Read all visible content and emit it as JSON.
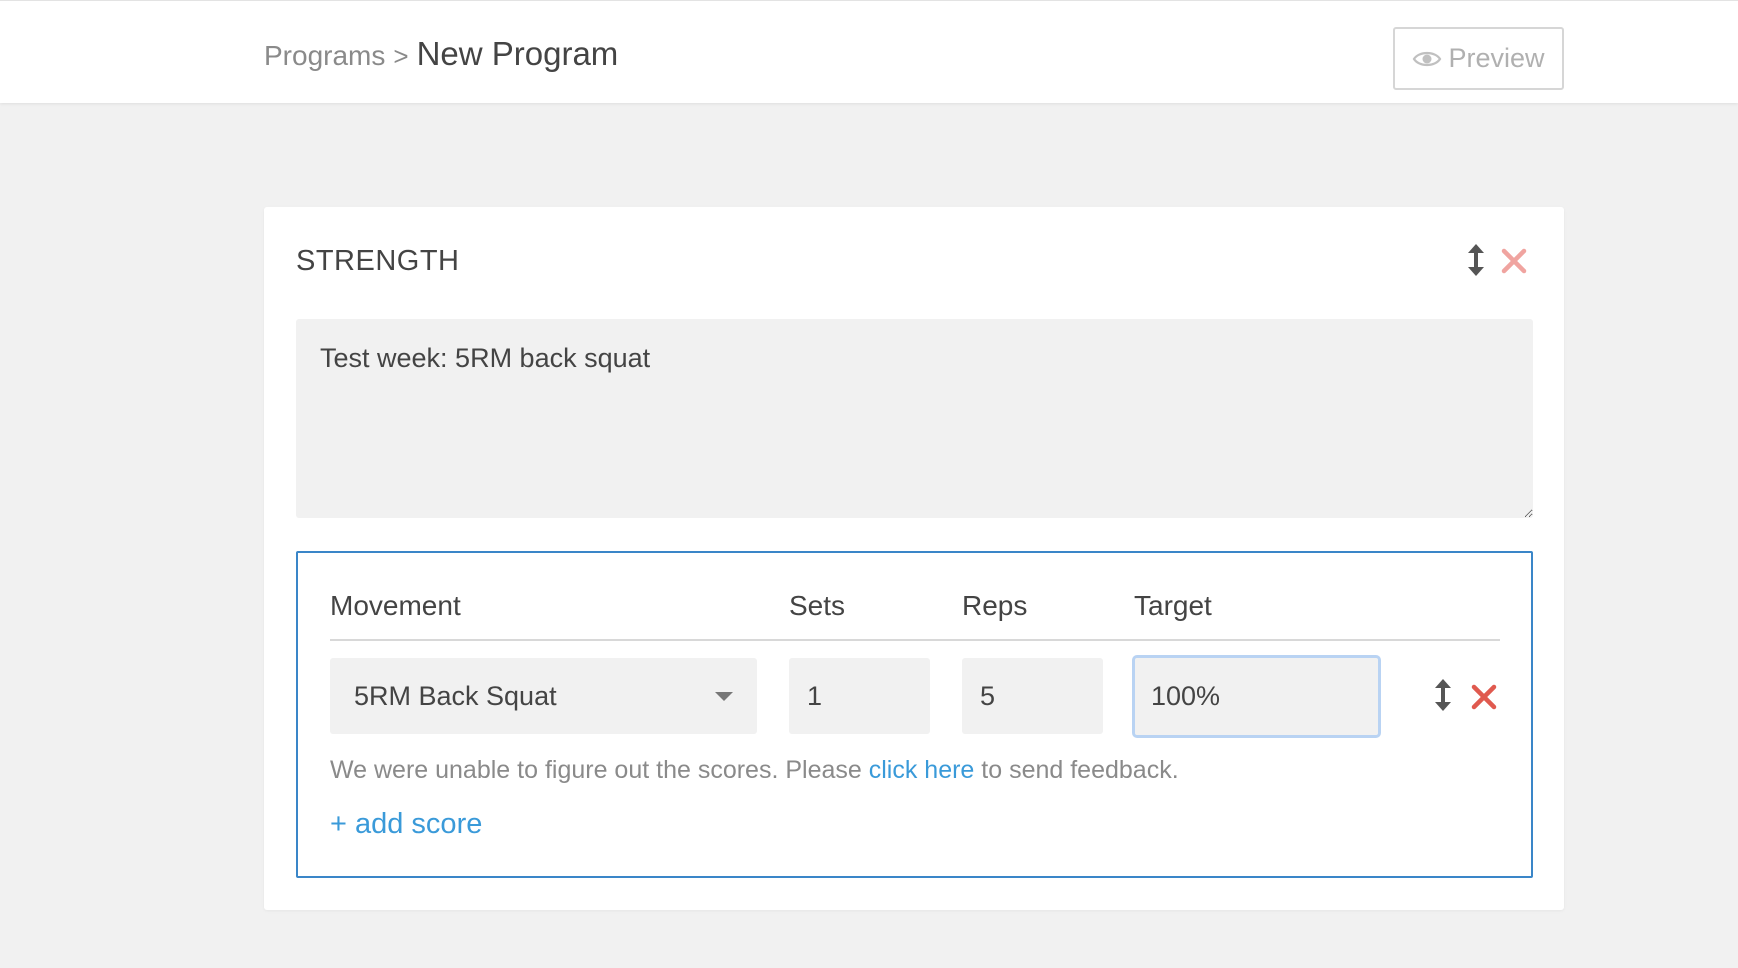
{
  "header": {
    "breadcrumb_parent": "Programs",
    "breadcrumb_separator": ">",
    "breadcrumb_current": "New Program",
    "preview_label": "Preview",
    "preview_icon": "eye-icon"
  },
  "section": {
    "title": "STRENGTH",
    "move_icon": "vertical-arrows-icon",
    "close_icon": "close-icon",
    "description": "Test week: 5RM back squat"
  },
  "scores": {
    "columns": {
      "movement": "Movement",
      "sets": "Sets",
      "reps": "Reps",
      "target": "Target"
    },
    "row": {
      "movement": "5RM Back Squat",
      "sets": "1",
      "reps": "5",
      "target": "100%"
    },
    "feedback": {
      "before": "We were unable to figure out the scores. Please ",
      "link": "click here",
      "after": " to send feedback."
    },
    "add_score_label": "+ add score"
  },
  "colors": {
    "accent_blue": "#3a9ad9",
    "box_border": "#3a86c8",
    "close_red_light": "#f0a4a0",
    "close_red": "#e05a4f",
    "focus_border": "#b9d3f3"
  }
}
